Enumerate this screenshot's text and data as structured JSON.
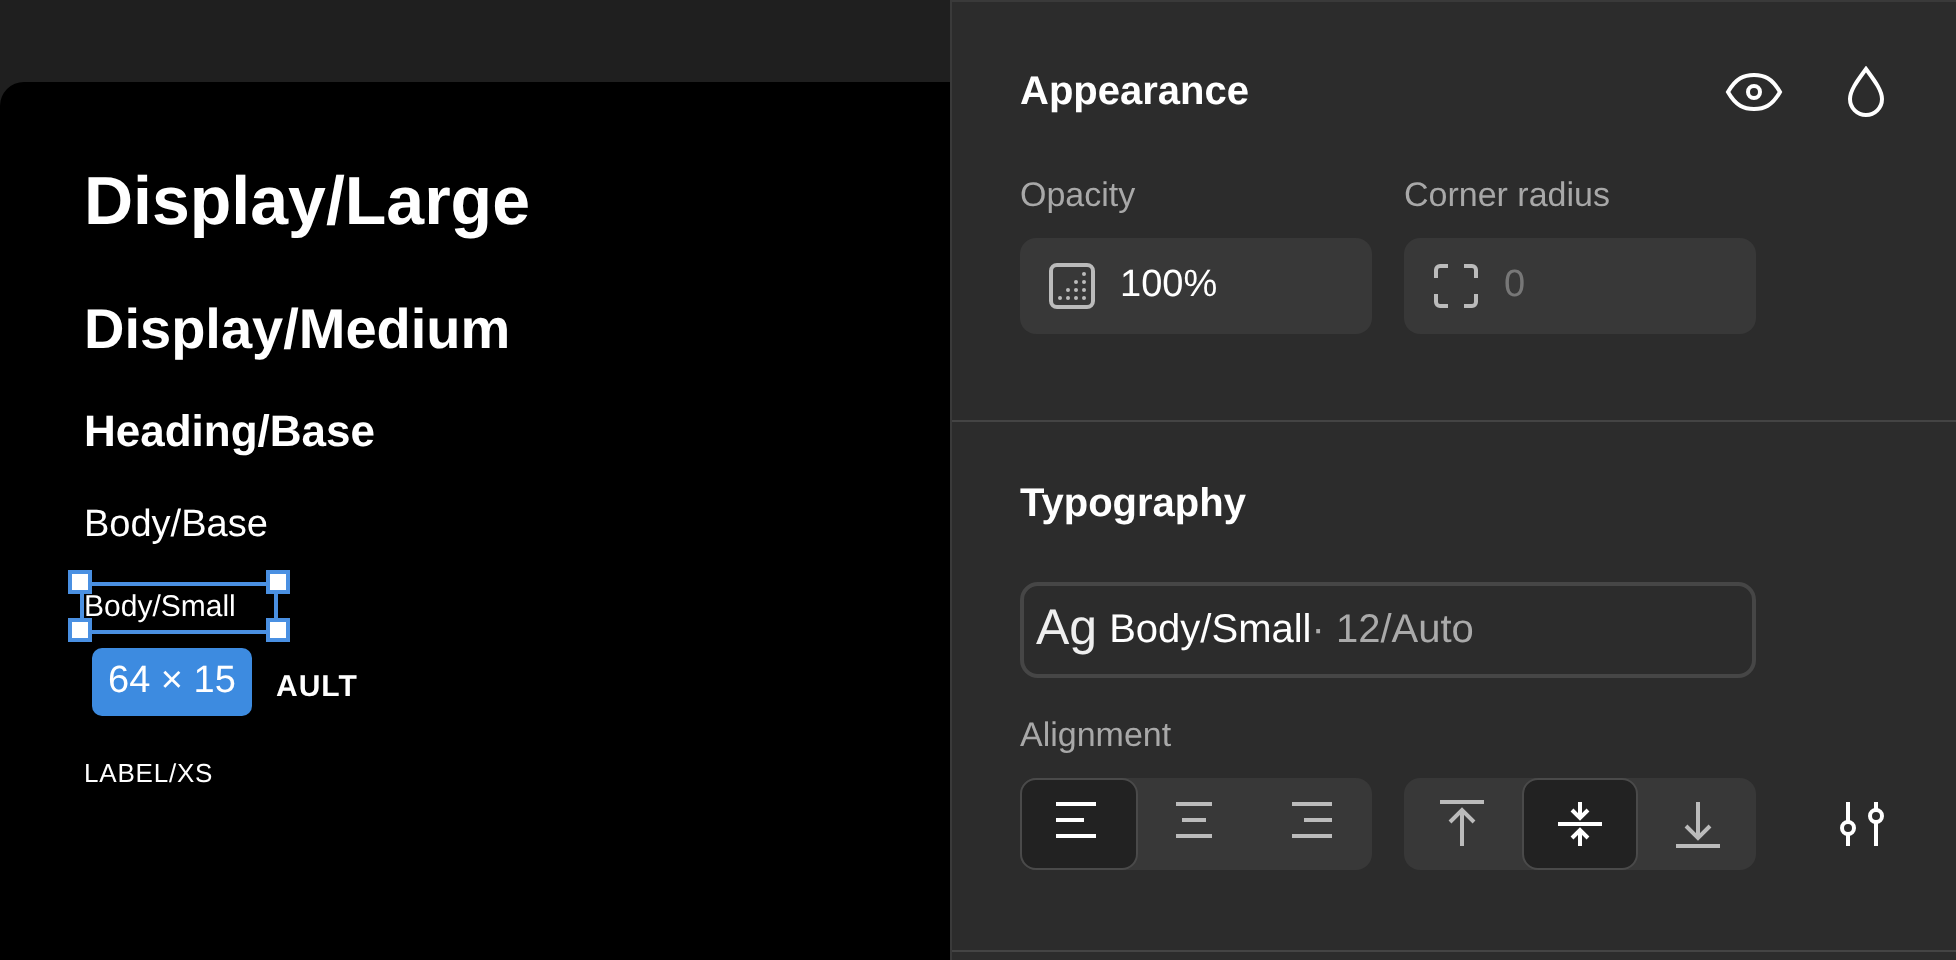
{
  "canvas": {
    "styles": [
      {
        "text": "Display/Large",
        "kind": "display-large",
        "selected": false
      },
      {
        "text": "Display/Medium",
        "kind": "display-medium",
        "selected": false
      },
      {
        "text": "Heading/Base",
        "kind": "heading-base",
        "selected": false
      },
      {
        "text": "Body/Base",
        "kind": "body-base",
        "selected": false
      },
      {
        "text": "Body/Small",
        "kind": "body-small",
        "selected": true
      },
      {
        "text": "AULT",
        "kind": "label-default",
        "selected": false
      },
      {
        "text": "LABEL/XS",
        "kind": "label-xs",
        "selected": false
      }
    ],
    "selection_size": "64 × 15"
  },
  "appearance": {
    "title": "Appearance",
    "opacity": {
      "label": "Opacity",
      "value": "100%"
    },
    "corner_radius": {
      "label": "Corner radius",
      "placeholder": "0"
    }
  },
  "typography": {
    "title": "Typography",
    "preview": "Ag",
    "style_name": "Body/Small",
    "style_detail": "· 12/Auto",
    "alignment_label": "Alignment",
    "horizontal": [
      {
        "kind": "left",
        "selected": true
      },
      {
        "kind": "center",
        "selected": false
      },
      {
        "kind": "right",
        "selected": false
      }
    ],
    "vertical": [
      {
        "kind": "top",
        "selected": false
      },
      {
        "kind": "middle",
        "selected": true
      },
      {
        "kind": "bottom",
        "selected": false
      }
    ]
  }
}
